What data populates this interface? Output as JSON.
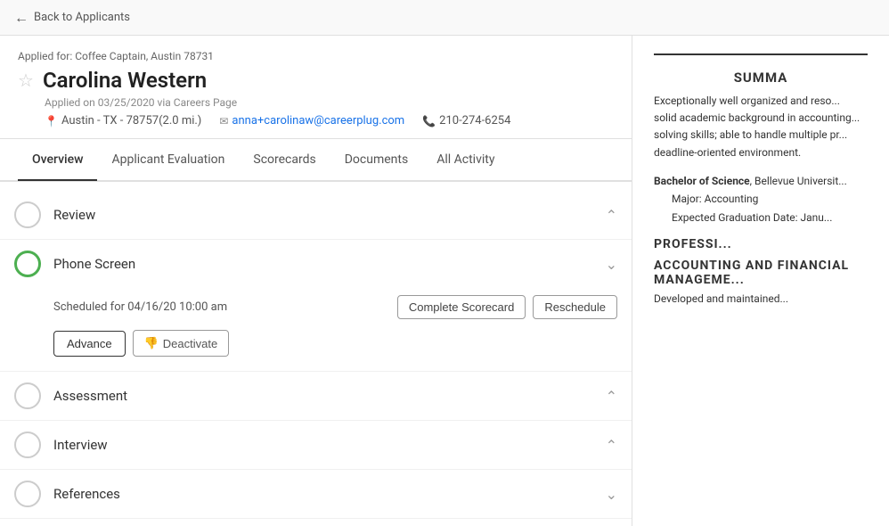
{
  "nav": {
    "back_label": "Back to Applicants"
  },
  "applicant": {
    "applied_for": "Applied for: Coffee Captain, Austin 78731",
    "name": "Carolina Western",
    "applied_on": "Applied on 03/25/2020 via Careers Page",
    "location": "Austin - TX - 78757(2.0 mi.)",
    "email": "anna+carolinaw@careerplug.com",
    "phone": "210-274-6254"
  },
  "tabs": [
    {
      "label": "Overview",
      "active": true
    },
    {
      "label": "Applicant Evaluation",
      "active": false
    },
    {
      "label": "Scorecards",
      "active": false
    },
    {
      "label": "Documents",
      "active": false
    },
    {
      "label": "All Activity",
      "active": false
    }
  ],
  "stages": [
    {
      "name": "Review",
      "state": "empty",
      "expanded": false
    },
    {
      "name": "Phone Screen",
      "state": "active",
      "expanded": true
    },
    {
      "name": "Assessment",
      "state": "empty",
      "expanded": false
    },
    {
      "name": "Interview",
      "state": "empty",
      "expanded": false
    },
    {
      "name": "References",
      "state": "empty",
      "expanded": false
    }
  ],
  "phone_screen": {
    "scheduled_text": "Scheduled for 04/16/20 10:00 am",
    "complete_scorecard": "Complete Scorecard",
    "reschedule": "Reschedule",
    "advance": "Advance",
    "deactivate": "Deactivate"
  },
  "resume": {
    "summary_title": "SUMM...",
    "summary_text": "Exceptionally well organized and reso... solid academic background in accounting... solving skills; able to handle multiple pr... deadline-oriented environment.",
    "education_degree": "Bachelor of Science",
    "education_university": ", Bellevue Universit...",
    "education_major": "Major:  Accounting",
    "education_graduation": "Expected Graduation Date:  Janu...",
    "prof_title": "PROFESSI...",
    "exp_title": "Accounting and Financial Manageme...",
    "exp_text": "Developed and maintained..."
  }
}
